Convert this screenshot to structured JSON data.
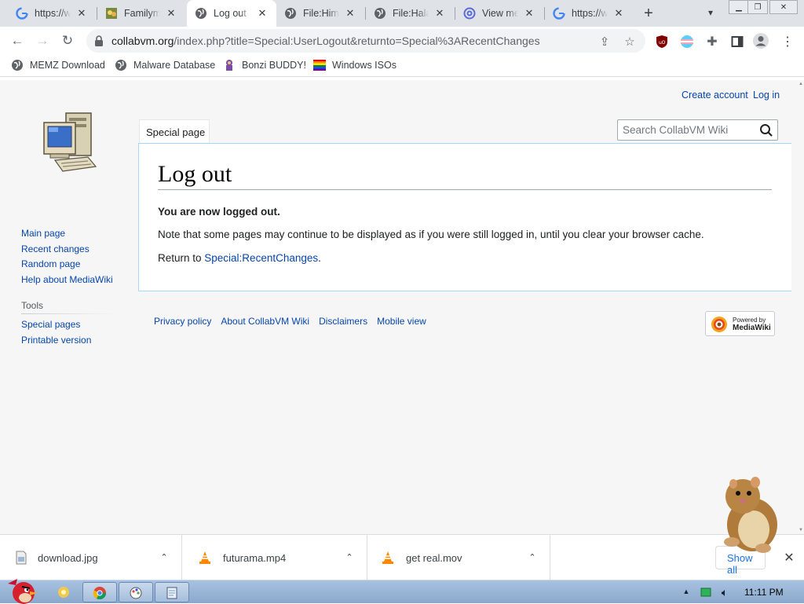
{
  "browser": {
    "tabs": [
      {
        "title": "https://w",
        "favicon": "google-icon",
        "active": false
      },
      {
        "title": "Familyma",
        "favicon": "family-favicon-icon",
        "active": false
      },
      {
        "title": "Log out",
        "favicon": "globe-icon",
        "active": true
      },
      {
        "title": "File:Him/",
        "favicon": "globe-icon",
        "active": false
      },
      {
        "title": "File:Halal",
        "favicon": "globe-icon",
        "active": false
      },
      {
        "title": "View me",
        "favicon": "at-sign-icon",
        "active": false
      },
      {
        "title": "https://w",
        "favicon": "google-icon",
        "active": false
      }
    ],
    "url_host": "collabvm.org",
    "url_rest": "/index.php?title=Special:UserLogout&returnto=Special%3ARecentChanges",
    "bookmarks": [
      {
        "label": "MEMZ Download",
        "icon": "globe-icon"
      },
      {
        "label": "Malware Database",
        "icon": "globe-icon"
      },
      {
        "label": "Bonzi BUDDY!",
        "icon": "bonzi-icon"
      },
      {
        "label": "Windows ISOs",
        "icon": "rainbow-flag-icon"
      }
    ]
  },
  "wiki": {
    "personal": {
      "create_account": "Create account",
      "log_in": "Log in"
    },
    "namespace_tab": "Special page",
    "search_placeholder": "Search CollabVM Wiki",
    "heading": "Log out",
    "logged_out": "You are now logged out.",
    "note": "Note that some pages may continue to be displayed as if you were still logged in, until you clear your browser cache.",
    "return_prefix": "Return to ",
    "return_link": "Special:RecentChanges",
    "return_suffix": ".",
    "navigation": [
      "Main page",
      "Recent changes",
      "Random page",
      "Help about MediaWiki"
    ],
    "tools_heading": "Tools",
    "tools": [
      "Special pages",
      "Printable version"
    ],
    "footer": [
      "Privacy policy",
      "About CollabVM Wiki",
      "Disclaimers",
      "Mobile view"
    ],
    "powered_line1": "Powered by",
    "powered_line2": "MediaWiki"
  },
  "downloads": {
    "items": [
      {
        "name": "download.jpg",
        "icon": "image-file-icon"
      },
      {
        "name": "futurama.mp4",
        "icon": "vlc-cone-icon"
      },
      {
        "name": "get real.mov",
        "icon": "vlc-cone-icon"
      }
    ],
    "show_all": "Show all"
  },
  "taskbar": {
    "time": "11:11 PM"
  },
  "colors": {
    "link": "#0645ad",
    "content_border": "#a7d7f9",
    "accent": "#1a73e8"
  }
}
